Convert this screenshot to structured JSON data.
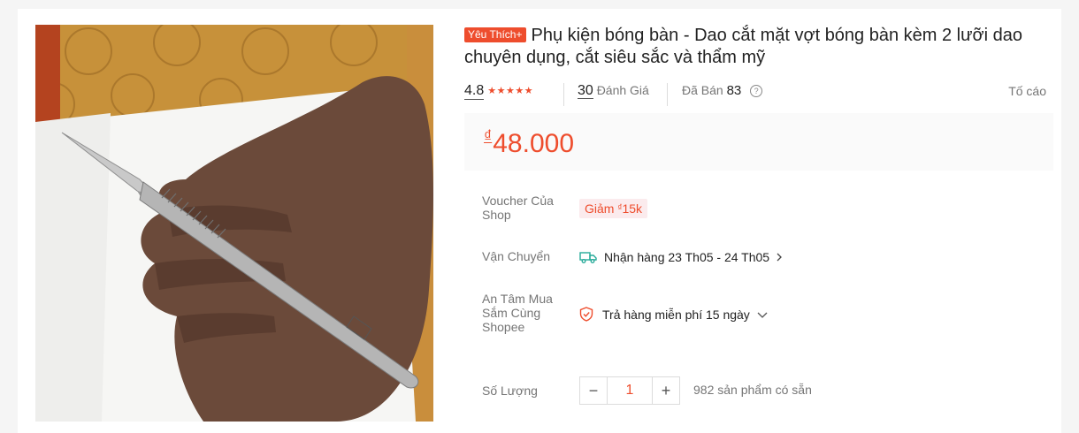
{
  "product": {
    "badge": "Yêu Thích+",
    "title": "Phụ kiện bóng bàn - Dao cắt mặt vợt bóng bàn kèm 2 lưỡi dao chuyên dụng, cắt siêu sắc và thẩm mỹ",
    "rating": "4.8",
    "stars": 5,
    "reviews_count": "30",
    "reviews_label": "Đánh Giá",
    "sold_label": "Đã Bán",
    "sold_count": "83",
    "report_label": "Tố cáo",
    "currency": "₫",
    "price": "48.000"
  },
  "voucher": {
    "label": "Voucher Của Shop",
    "value_prefix": "Giảm ",
    "currency": "₫",
    "value": "15k"
  },
  "shipping": {
    "label": "Vận Chuyển",
    "value": "Nhận hàng 23 Th05 - 24 Th05"
  },
  "guarantee": {
    "label": "An Tâm Mua Sắm Cùng Shopee",
    "value": "Trả hàng miễn phí 15 ngày"
  },
  "quantity": {
    "label": "Số Lượng",
    "minus": "−",
    "value": "1",
    "plus": "+",
    "stock": "982 sản phẩm có sẵn"
  },
  "colors": {
    "accent": "#ee4d2d",
    "truck": "#26aa99"
  },
  "icons": [
    "star-icon",
    "help-icon",
    "truck-icon",
    "chevron-right-icon",
    "shield-icon",
    "chevron-down-icon"
  ]
}
